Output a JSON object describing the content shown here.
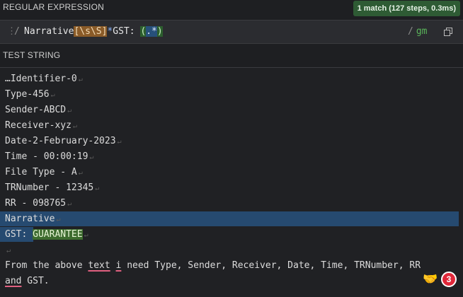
{
  "regex_section": {
    "label": "REGULAR EXPRESSION",
    "match_info": "1 match (127 steps, 0.3ms)",
    "delimiter_open": "/",
    "pattern_literal": "Narrative",
    "pattern_class": "[\\s\\S]",
    "pattern_quant": "*",
    "pattern_literal2": "GST: ",
    "pattern_group_open": "(",
    "pattern_group_inner": ".*",
    "pattern_group_close": ")",
    "delimiter_close": "/",
    "flags": "gm"
  },
  "test_section": {
    "label": "TEST STRING",
    "lines": [
      "…Identifier-0",
      "Type-456",
      "Sender-ABCD",
      "Receiver-xyz",
      "Date-2-February-2023",
      "Time - 00:00:19",
      "File Type - A",
      "TRNumber - 12345",
      "RR - 098765",
      "Narrative"
    ],
    "gst_prefix": "GST: ",
    "gst_value": "GUARANTEE",
    "para_part1": "From the above ",
    "para_text": "text",
    "para_space": " ",
    "para_i": "i",
    "para_part2": " need Type, Sender, Receiver, Date, Time, TRNumber, RR",
    "para_and": "and",
    "para_part3": " GST."
  },
  "overlay": {
    "helper_icon": "handshake-icon",
    "notification_count": "3"
  },
  "colors": {
    "match_highlight": "#264a70",
    "group_highlight": "#3d6b2f",
    "badge": "#e0283a"
  }
}
